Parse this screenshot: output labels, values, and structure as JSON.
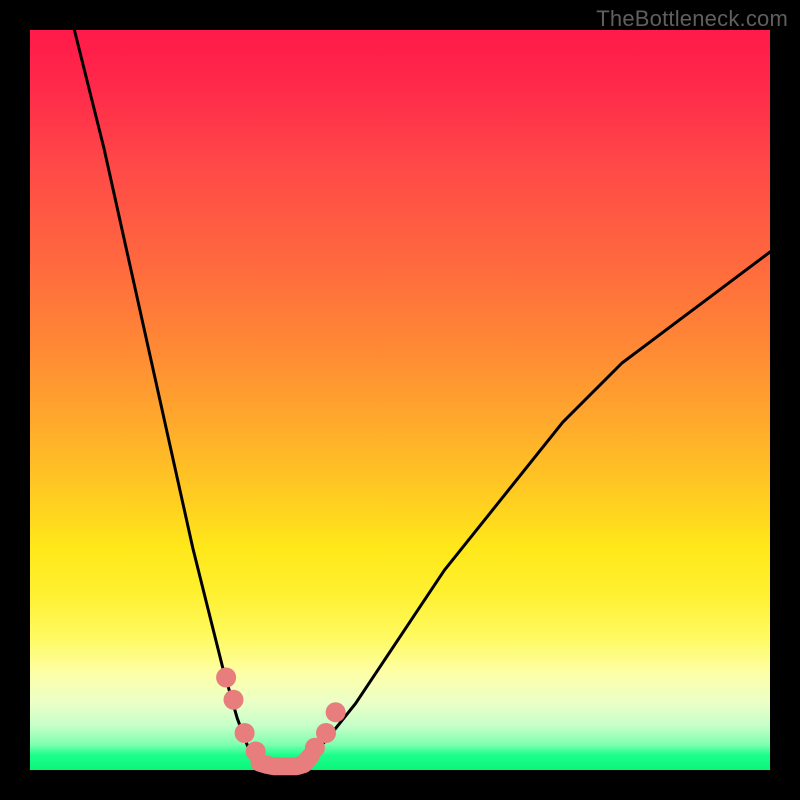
{
  "watermark": "TheBottleneck.com",
  "chart_data": {
    "type": "line",
    "title": "",
    "xlabel": "",
    "ylabel": "",
    "xlim": [
      0,
      100
    ],
    "ylim": [
      0,
      100
    ],
    "grid": false,
    "legend": false,
    "series": [
      {
        "name": "left-branch",
        "color": "#000000",
        "x": [
          6,
          8,
          10,
          12,
          14,
          16,
          18,
          20,
          22,
          24,
          26,
          28,
          29.5,
          31
        ],
        "values": [
          100,
          92,
          84,
          75,
          66,
          57,
          48,
          39,
          30,
          22,
          14,
          7,
          3,
          1
        ]
      },
      {
        "name": "right-branch",
        "color": "#000000",
        "x": [
          38,
          40,
          44,
          48,
          52,
          56,
          60,
          64,
          68,
          72,
          76,
          80,
          84,
          88,
          92,
          96,
          100
        ],
        "values": [
          2,
          4,
          9,
          15,
          21,
          27,
          32,
          37,
          42,
          47,
          51,
          55,
          58,
          61,
          64,
          67,
          70
        ]
      },
      {
        "name": "valley-floor",
        "color": "#E77D7D",
        "x": [
          31,
          32,
          33,
          34,
          35,
          36,
          37,
          38
        ],
        "values": [
          1,
          0.7,
          0.5,
          0.5,
          0.5,
          0.5,
          0.8,
          2
        ]
      },
      {
        "name": "left-markers",
        "type": "scatter",
        "color": "#E77D7D",
        "x": [
          26.5,
          27.5,
          29,
          30.5
        ],
        "values": [
          12.5,
          9.5,
          5,
          2.5
        ]
      },
      {
        "name": "right-markers",
        "type": "scatter",
        "color": "#E77D7D",
        "x": [
          38.5,
          40,
          41.3
        ],
        "values": [
          3,
          5,
          7.8
        ]
      }
    ],
    "background_gradient_stops": [
      {
        "pct": 0,
        "color": "#ff1a4a"
      },
      {
        "pct": 18,
        "color": "#ff4848"
      },
      {
        "pct": 44,
        "color": "#ff8c34"
      },
      {
        "pct": 70,
        "color": "#ffe81a"
      },
      {
        "pct": 87,
        "color": "#fdffa8"
      },
      {
        "pct": 96,
        "color": "#80ffb0"
      },
      {
        "pct": 100,
        "color": "#0cf57a"
      }
    ]
  }
}
